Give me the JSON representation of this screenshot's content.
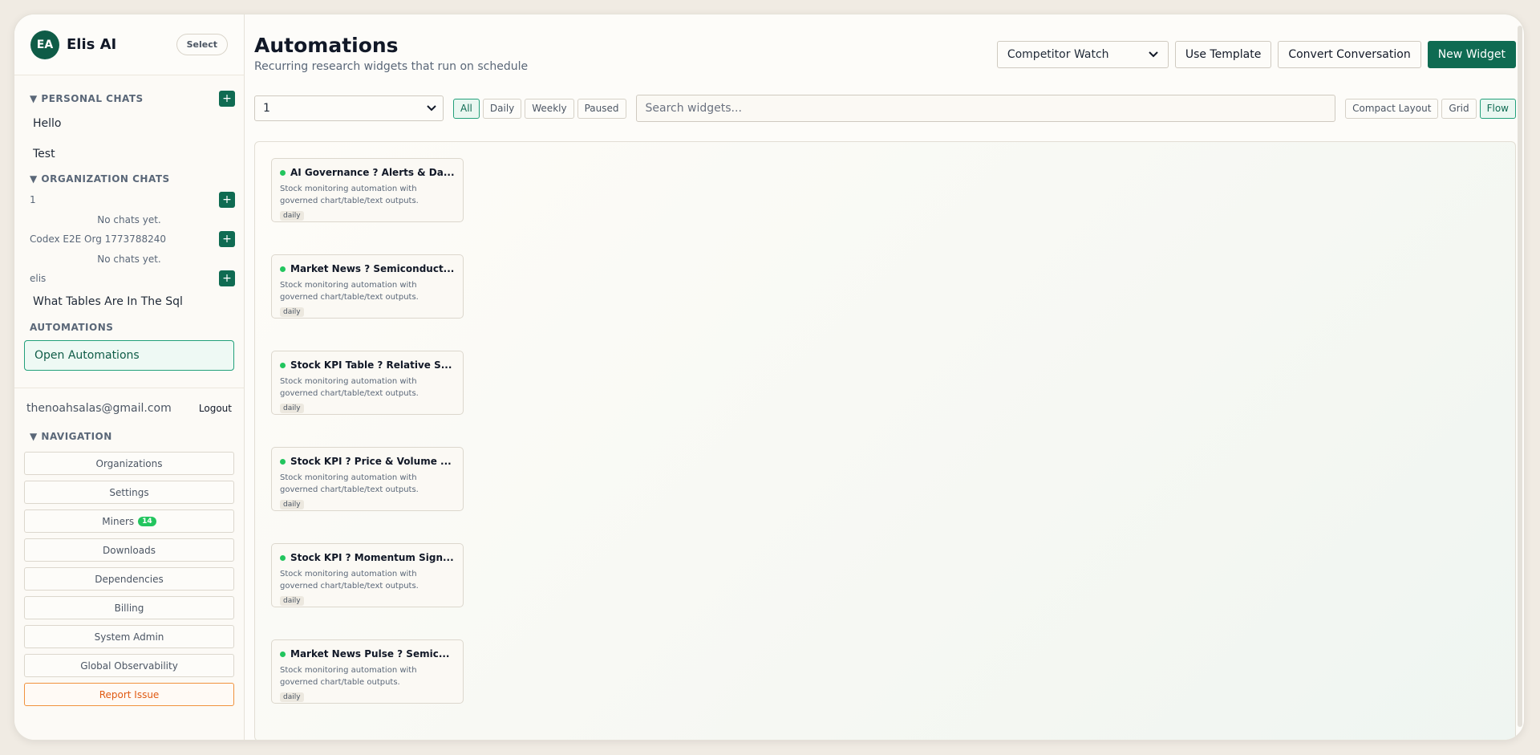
{
  "brand": {
    "initials": "EA",
    "name": "Elis AI",
    "select_label": "Select"
  },
  "sidebar": {
    "personal": {
      "heading": "▼ PERSONAL CHATS",
      "chats": [
        "Hello",
        "Test"
      ]
    },
    "organization": {
      "heading": "▼ ORGANIZATION CHATS",
      "orgs": [
        {
          "name": "1",
          "empty": "No chats yet."
        },
        {
          "name": "Codex E2E Org 1773788240",
          "empty": "No chats yet."
        },
        {
          "name": "elis",
          "chat": "What Tables Are In The Sql"
        }
      ]
    },
    "automations": {
      "heading": "AUTOMATIONS",
      "open_label": "Open Automations"
    },
    "user": {
      "email": "thenoahsalas@gmail.com",
      "logout": "Logout"
    },
    "navigation": {
      "heading": "▼ NAVIGATION",
      "items": [
        "Organizations",
        "Settings",
        "Miners",
        "Downloads",
        "Dependencies",
        "Billing",
        "System Admin",
        "Global Observability"
      ],
      "miners_badge": "14",
      "report": "Report Issue"
    },
    "plus": "+"
  },
  "header": {
    "title": "Automations",
    "subtitle": "Recurring research widgets that run on schedule",
    "template_select": "Competitor Watch",
    "use_template": "Use Template",
    "convert": "Convert Conversation",
    "new_widget": "New Widget"
  },
  "toolbar": {
    "org_select": "1",
    "filters": [
      "All",
      "Daily",
      "Weekly",
      "Paused"
    ],
    "active_filter": "All",
    "search_placeholder": "Search widgets...",
    "layouts": [
      "Compact Layout",
      "Grid",
      "Flow"
    ],
    "active_layout": "Flow"
  },
  "widgets": [
    {
      "title": "AI Governance ? Alerts & Da...",
      "desc": "Stock monitoring automation with governed chart/table/text outputs.",
      "tag": "daily"
    },
    {
      "title": "Market News ? Semiconduct...",
      "desc": "Stock monitoring automation with governed chart/table/text outputs.",
      "tag": "daily"
    },
    {
      "title": "Stock KPI Table ? Relative S...",
      "desc": "Stock monitoring automation with governed chart/table/text outputs.",
      "tag": "daily"
    },
    {
      "title": "Stock KPI ? Price & Volume ...",
      "desc": "Stock monitoring automation with governed chart/table/text outputs.",
      "tag": "daily"
    },
    {
      "title": "Stock KPI ? Momentum Sign...",
      "desc": "Stock monitoring automation with governed chart/table/text outputs.",
      "tag": "daily"
    },
    {
      "title": "Market News Pulse ? Semic...",
      "desc": "Stock monitoring automation with governed chart/table outputs.",
      "tag": "daily"
    }
  ],
  "colors": {
    "brand": "#0f6b52",
    "status_active": "#22c55e",
    "report": "#e05a12"
  },
  "icons": {
    "dropdown": "chevron-down-icon",
    "status": "status-dot-icon",
    "add": "plus-icon"
  }
}
